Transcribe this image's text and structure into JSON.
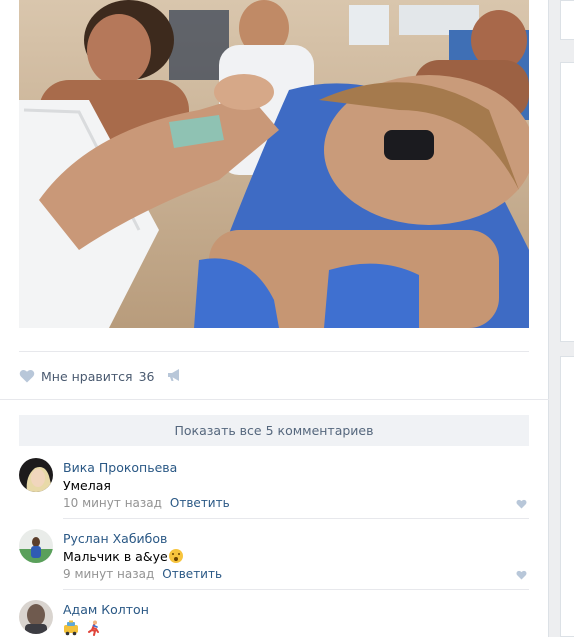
{
  "post": {
    "photo_description_icon": "photo",
    "like_label": "Мне нравится",
    "like_count": "36",
    "share_icon": "megaphone-icon",
    "show_all_comments": "Показать все 5 комментариев"
  },
  "comments": [
    {
      "author": "Вика Прокопьева",
      "text": "Умелая",
      "time": "10 минут назад",
      "reply": "Ответить",
      "emoji": ""
    },
    {
      "author": "Руслан Хабибов",
      "text": "Мальчик в а&уе",
      "time": "9 минут назад",
      "reply": "Ответить",
      "emoji": "astonished-face"
    },
    {
      "author": "Адам Колтон",
      "text": "",
      "time": "",
      "reply": "",
      "emoji": "taxi-and-runner"
    }
  ],
  "colors": {
    "link": "#2a5885",
    "meta": "#939393",
    "button_bg": "#f0f2f5",
    "background": "#edeef0"
  }
}
